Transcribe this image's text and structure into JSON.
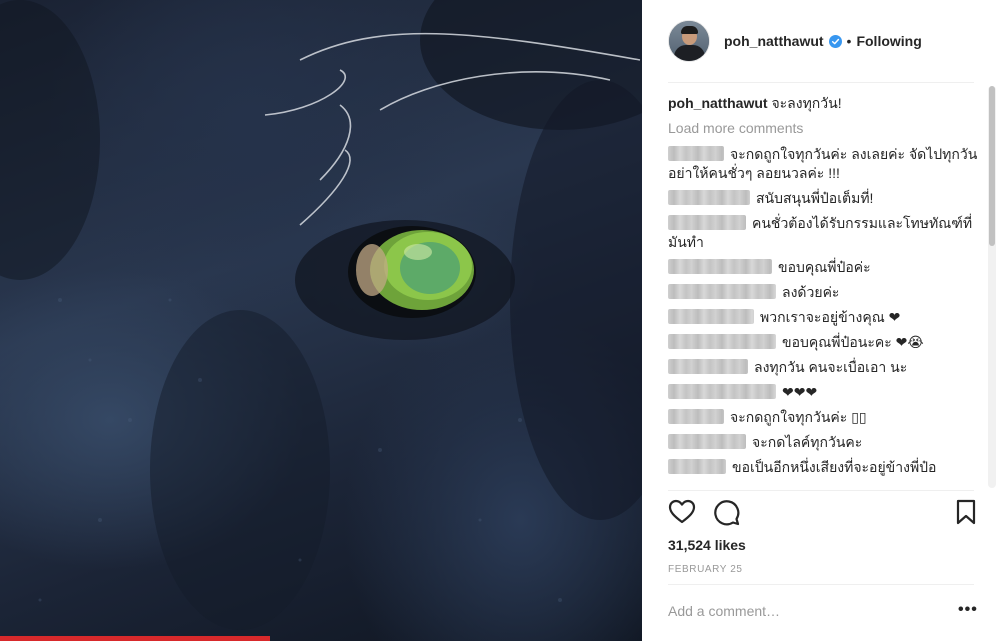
{
  "post": {
    "username": "poh_natthawut",
    "follow_status": "Following",
    "separator": "•",
    "caption_text": "จะลงทุกวัน!",
    "load_more": "Load more comments",
    "likes": "31,524 likes",
    "date": "FEBRUARY 25",
    "add_comment_placeholder": "Add a comment…",
    "more_options": "•••"
  },
  "comments": [
    {
      "text": "จะกดถูกใจทุกวันค่ะ ลงเลยค่ะ จัดไปทุกวัน อย่าให้คนชั่วๆ ลอยนวลค่ะ !!!"
    },
    {
      "text": "สนับสนุนพี่ป๋อเต็มที่!"
    },
    {
      "text": "คนชั่วต้องได้รับกรรมและโทษทัณฑ์ที่มันทำ"
    },
    {
      "text": "ขอบคุณพี่ป๋อค่ะ"
    },
    {
      "text": "ลงด้วยค่ะ"
    },
    {
      "text": "พวกเราจะอยู่ข้างคุณ ❤"
    },
    {
      "text": "ขอบคุณพี่ป๋อนะคะ ❤😭"
    },
    {
      "text": "ลงทุกวัน คนจะเบื่อเอา นะ"
    },
    {
      "text": "❤❤❤"
    },
    {
      "text": "จะกดถูกใจทุกวันค่ะ ▯▯"
    },
    {
      "text": "จะกดไลค์ทุกวันคะ"
    },
    {
      "text": "ขอเป็นอีกหนึ่งเสียงที่จะอยู่ข้างพี่ป๋อ"
    }
  ],
  "icons": {
    "like": "heart-outline-icon",
    "comment": "speech-bubble-icon",
    "save": "bookmark-icon",
    "verified": "verified-badge-icon"
  },
  "colors": {
    "verified": "#3897f0",
    "secondary_text": "#999999",
    "photo_progress": "#d8292b"
  }
}
